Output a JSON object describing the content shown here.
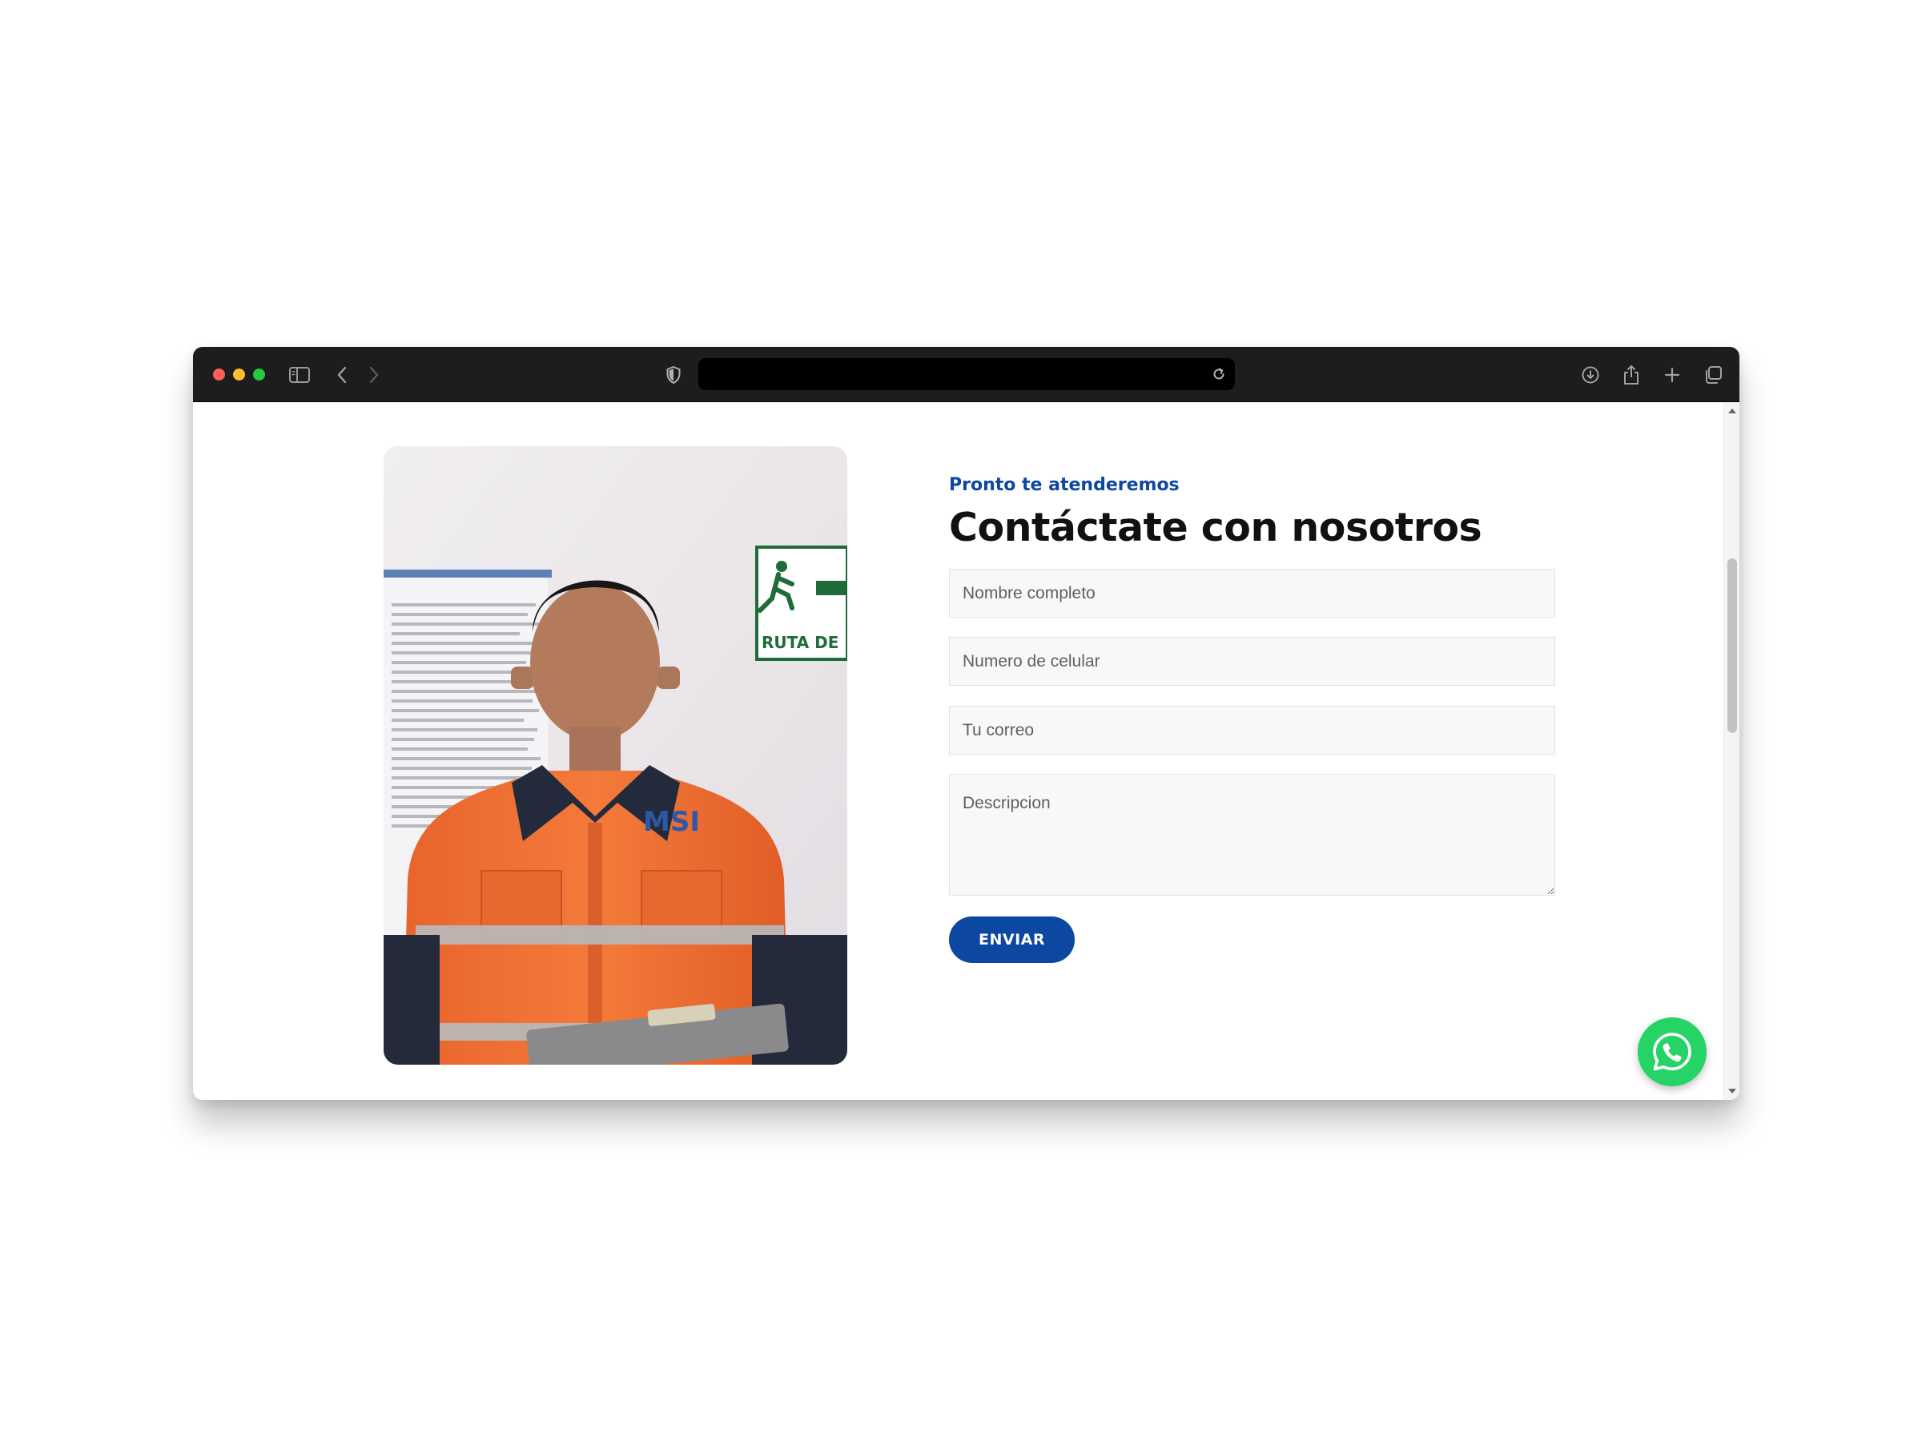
{
  "browser": {
    "url_text": ""
  },
  "contact": {
    "eyebrow": "Pronto te atenderemos",
    "title": "Contáctate con nosotros",
    "fields": {
      "name_placeholder": "Nombre completo",
      "phone_placeholder": "Numero de celular",
      "email_placeholder": "Tu correo",
      "description_placeholder": "Descripcion"
    },
    "submit_label": "ENVIAR"
  },
  "photo": {
    "sign_text": "RUTA DE EVA",
    "badge_text": "MSI"
  },
  "colors": {
    "accent": "#0c47a1",
    "whatsapp": "#25d366",
    "toolbar": "#1d1d1f"
  },
  "icons": {
    "floating": "whatsapp-icon"
  }
}
